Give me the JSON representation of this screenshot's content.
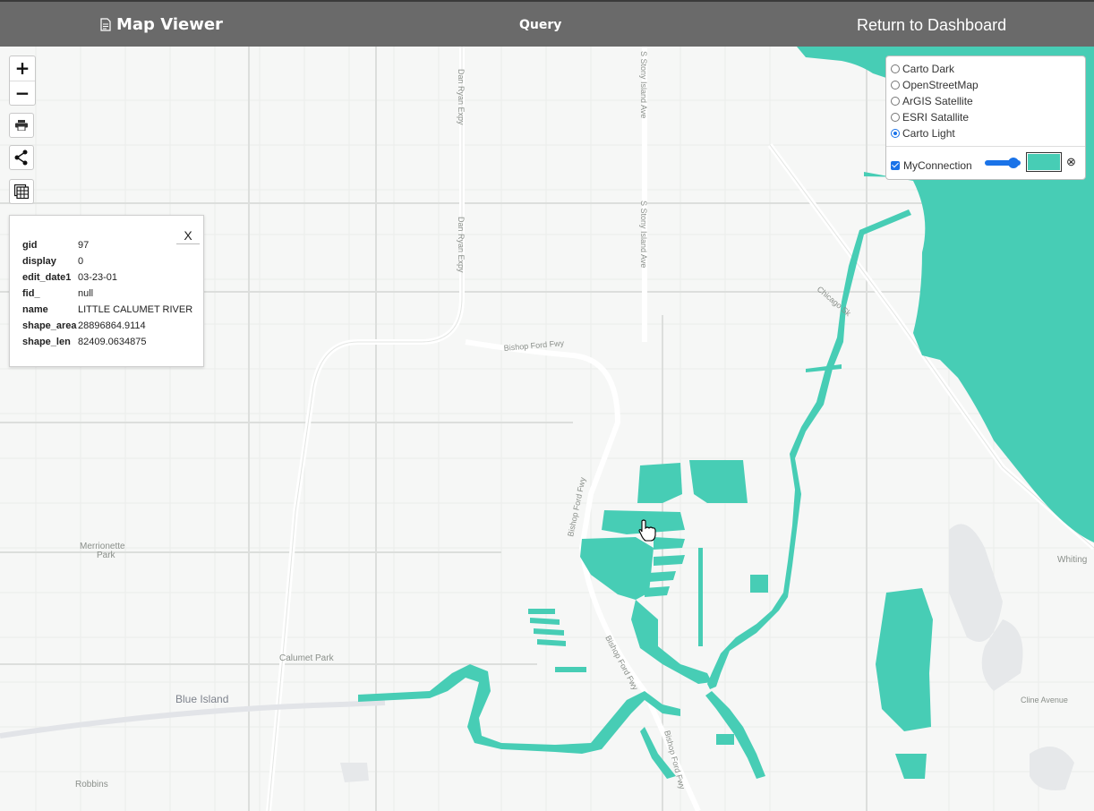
{
  "header": {
    "app_title": "Map Viewer",
    "app_icon": "document-icon",
    "query_label": "Query",
    "return_label": "Return to Dashboard"
  },
  "map": {
    "water_color": "#47cdb5",
    "place_labels": [
      "Dan Ryan Expy",
      "S Stony Island Ave",
      "Bishop Ford Fwy",
      "Merrionette",
      "Park",
      "Calumet Park",
      "Blue Island",
      "Robbins",
      "Whiting",
      "Cline Avenue",
      "Chicago Sk"
    ],
    "cursor": "hand-pointer-icon"
  },
  "controls": {
    "zoom_in": "+",
    "zoom_out": "−",
    "print_icon": "print-icon",
    "share_icon": "share-icon",
    "table_icon": "table-icon"
  },
  "popup": {
    "close_label": "X",
    "rows": [
      {
        "key": "gid",
        "value": "97"
      },
      {
        "key": "display",
        "value": "0"
      },
      {
        "key": "edit_date1",
        "value": "03-23-01"
      },
      {
        "key": "fid_",
        "value": "null"
      },
      {
        "key": "name",
        "value": "LITTLE CALUMET RIVER"
      },
      {
        "key": "shape_area",
        "value": "28896864.9114"
      },
      {
        "key": "shape_len",
        "value": "82409.0634875"
      }
    ]
  },
  "layers": {
    "base_layers": [
      {
        "label": "Carto Dark",
        "selected": false
      },
      {
        "label": "OpenStreetMap",
        "selected": false
      },
      {
        "label": "ArGIS Satellite",
        "selected": false
      },
      {
        "label": "ESRI Satallite",
        "selected": false
      },
      {
        "label": "Carto Light",
        "selected": true
      }
    ],
    "overlay": {
      "label": "MyConnection",
      "checked": true,
      "color": "#47cdb5",
      "remove_icon": "⊗"
    }
  }
}
